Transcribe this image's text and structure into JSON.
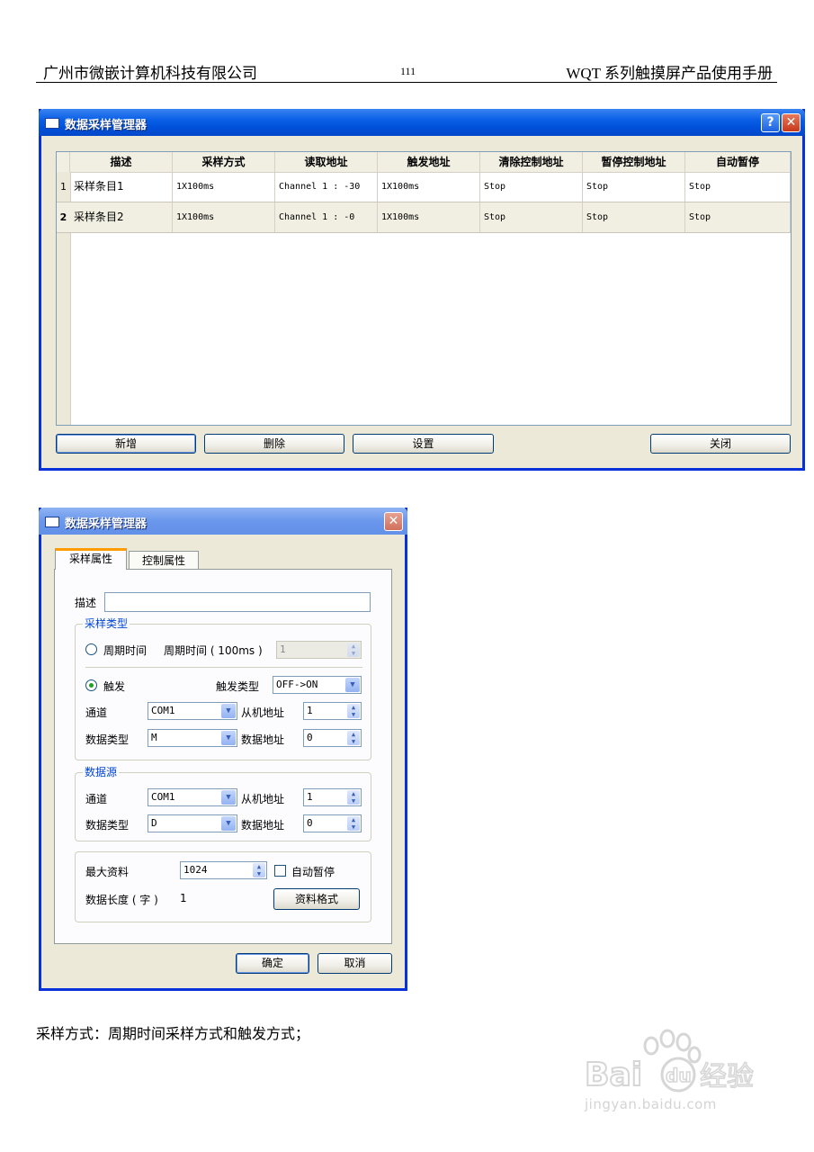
{
  "header": {
    "left": "广州市微嵌计算机科技有限公司",
    "page_number": "111",
    "right": "WQT 系列触摸屏产品使用手册"
  },
  "dialog1": {
    "title": "数据采样管理器",
    "help_glyph": "?",
    "close_glyph": "✕",
    "columns": [
      "描述",
      "采样方式",
      "读取地址",
      "触发地址",
      "清除控制地址",
      "暂停控制地址",
      "自动暂停"
    ],
    "rows": [
      {
        "num": "1",
        "cells": [
          "采样条目1",
          "1X100ms",
          "Channel 1 : -30",
          "1X100ms",
          "Stop",
          "Stop",
          "Stop"
        ]
      },
      {
        "num": "2",
        "cells": [
          "采样条目2",
          "1X100ms",
          "Channel 1 : -0",
          "1X100ms",
          "Stop",
          "Stop",
          "Stop"
        ]
      }
    ],
    "buttons": {
      "add": "新增",
      "delete": "删除",
      "settings": "设置",
      "close": "关闭"
    }
  },
  "dialog2": {
    "title": "数据采样管理器",
    "close_glyph": "✕",
    "tabs": [
      "采样属性",
      "控制属性"
    ],
    "description_label": "描述",
    "description_value": "",
    "sample_type": {
      "group_title": "采样类型",
      "periodic_label": "周期时间",
      "period_label": "周期时间 ( 100ms )",
      "period_value": "1",
      "trigger_label": "触发",
      "trigger_type_label": "触发类型",
      "trigger_type_value": "OFF->ON",
      "channel_label": "通道",
      "channel_value": "COM1",
      "slave_label": "从机地址",
      "slave_value": "1",
      "data_type_label": "数据类型",
      "data_type_value": "M",
      "data_addr_label": "数据地址",
      "data_addr_value": "0"
    },
    "data_source": {
      "group_title": "数据源",
      "channel_label": "通道",
      "channel_value": "COM1",
      "slave_label": "从机地址",
      "slave_value": "1",
      "data_type_label": "数据类型",
      "data_type_value": "D",
      "data_addr_label": "数据地址",
      "data_addr_value": "0"
    },
    "max_data_label": "最大资料",
    "max_data_value": "1024",
    "auto_pause_label": "自动暂停",
    "data_length_label": "数据长度 ( 字 )",
    "data_length_value": "1",
    "format_button": "资料格式",
    "ok_button": "确定",
    "cancel_button": "取消"
  },
  "caption": "采样方式：周期时间采样方式和触发方式；",
  "watermark": {
    "logo": "Bai du 经验",
    "url": "jingyan.baidu.com"
  }
}
